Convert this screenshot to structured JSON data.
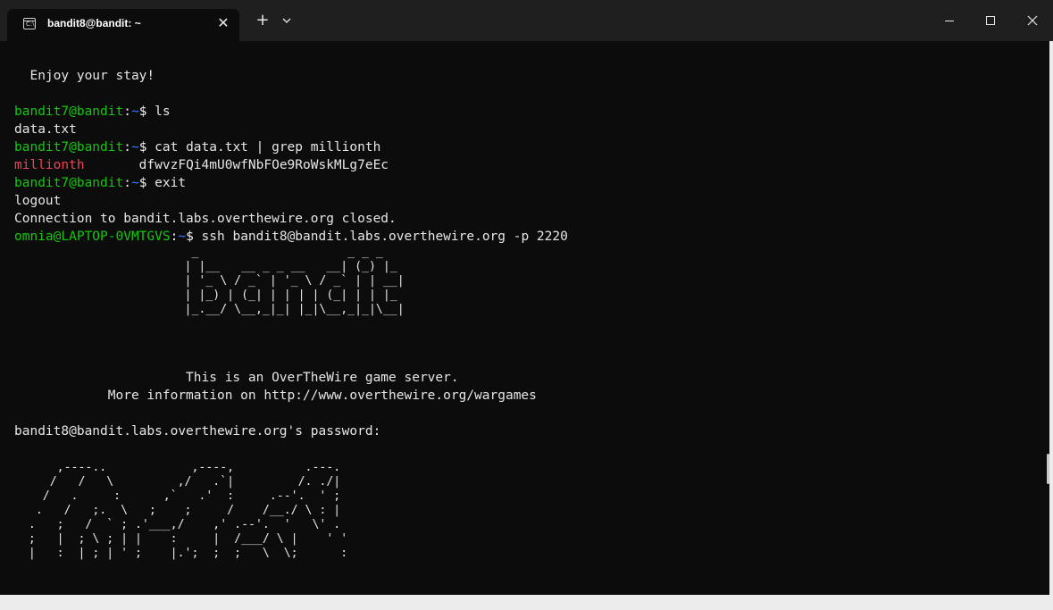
{
  "window": {
    "tab_title": "bandit8@bandit: ~",
    "tab_icon": "terminal-icon",
    "tab_icon_glyph": "C:\\",
    "close_glyph": "✕",
    "new_tab_glyph": "+",
    "colors": {
      "titlebar": "#1f1f1f",
      "background": "#0c0c0c",
      "prompt_user": "#16c60c",
      "prompt_path": "#3b78ff",
      "match_highlight": "#e74856",
      "text": "#e6e6e6"
    }
  },
  "terminal": {
    "enjoy": "  Enjoy your stay!",
    "p1_user": "bandit7@bandit",
    "p1_sep": ":",
    "p1_path": "~",
    "p1_dollar": "$ ",
    "p1_cmd": "ls",
    "out_ls": "data.txt",
    "p2_user": "bandit7@bandit",
    "p2_sep": ":",
    "p2_path": "~",
    "p2_dollar": "$ ",
    "p2_cmd": "cat data.txt | grep millionth",
    "match_word": "millionth",
    "match_rest": "       dfwvzFQi4mU0wfNbFOe9RoWskMLg7eEc",
    "p3_user": "bandit7@bandit",
    "p3_sep": ":",
    "p3_path": "~",
    "p3_dollar": "$ ",
    "p3_cmd": "exit",
    "out_logout": "logout",
    "out_closed": "Connection to bandit.labs.overthewire.org closed.",
    "p4_user": "omnia@LAPTOP-0VMTGVS",
    "p4_sep": ":",
    "p4_path": "~",
    "p4_dollar": "$ ",
    "p4_cmd": "ssh bandit8@bandit.labs.overthewire.org -p 2220",
    "banner_art": [
      "                         _                     _ _ _   ",
      "                        | |__   __ _ _ __   __| (_) |_ ",
      "                        | '_ \\ / _` | '_ \\ / _` | | __|",
      "                        | |_) | (_| | | | | (_| | | |_ ",
      "                        |_.__/ \\__,_|_| |_|\\__,_|_|\\__|"
    ],
    "server_line": "                      This is an OverTheWire game server.",
    "info_line": "            More information on http://www.overthewire.org/wargames",
    "password_prompt": "bandit8@bandit.labs.overthewire.org's password:",
    "logo_art": [
      "      ,----..            ,----,          .---.",
      "     /   /   \\         ,/   .`|         /. ./|",
      "    /   .     :      ,`   .'  :     .--'.  ' ;",
      "   .   /   ;.  \\   ;    ;     /    /__./ \\ : |",
      "  .   ;   /  ` ; .'___,/    ,' .--'.  '   \\' .",
      "  ;   |  ; \\ ; | |    :     |  /___/ \\ |    ' '",
      "  |   :  | ; | ' ;    |.';  ;  ;   \\  \\;      :"
    ]
  }
}
